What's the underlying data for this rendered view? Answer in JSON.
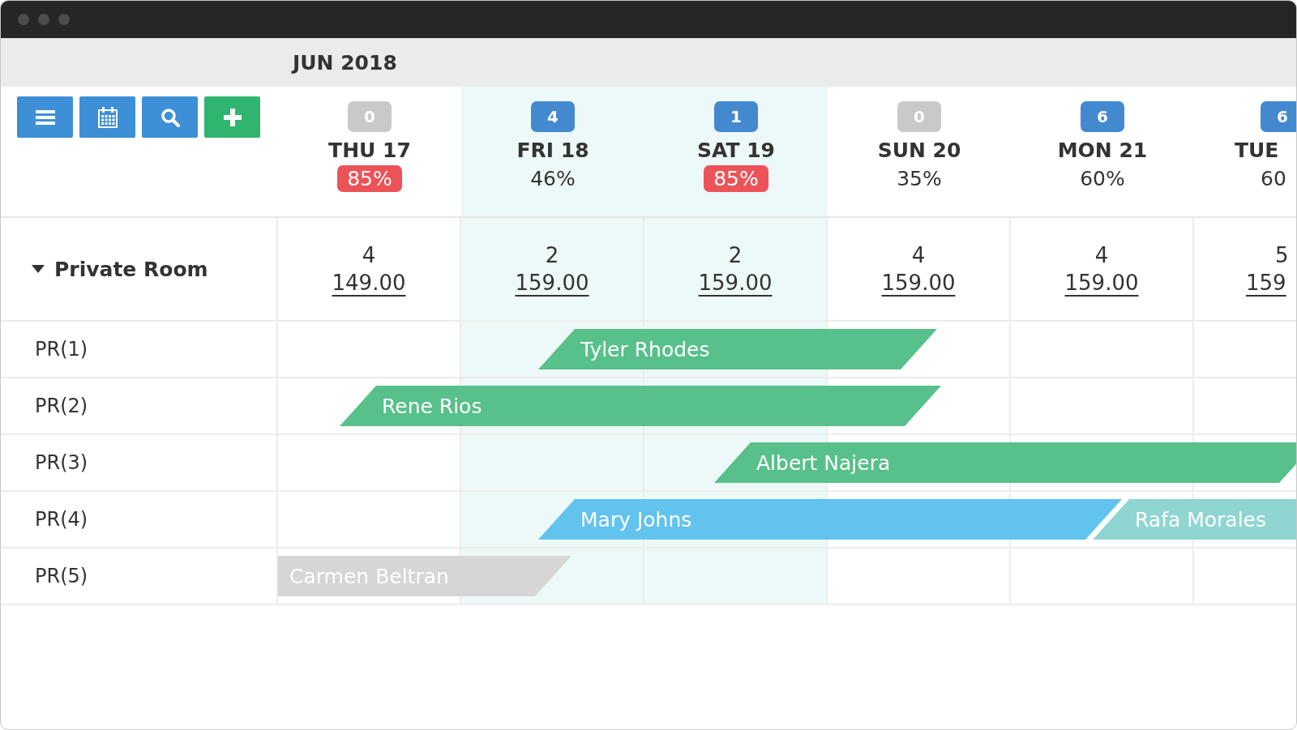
{
  "calendar": {
    "month": "JUN 2018"
  },
  "toolbar": [
    {
      "kind": "menu",
      "color": "#3d8fd6"
    },
    {
      "kind": "calendar",
      "color": "#3d8fd6"
    },
    {
      "kind": "search",
      "color": "#3d8fd6"
    },
    {
      "kind": "add",
      "color": "#2fb56f"
    }
  ],
  "days": [
    {
      "count": "0",
      "badge_active": false,
      "label": "THU 17",
      "occupancy": "85%",
      "alert": true,
      "highlighted": false
    },
    {
      "count": "4",
      "badge_active": true,
      "label": "FRI 18",
      "occupancy": "46%",
      "alert": false,
      "highlighted": true
    },
    {
      "count": "1",
      "badge_active": true,
      "label": "SAT 19",
      "occupancy": "85%",
      "alert": true,
      "highlighted": true
    },
    {
      "count": "0",
      "badge_active": false,
      "label": "SUN 20",
      "occupancy": "35%",
      "alert": false,
      "highlighted": false
    },
    {
      "count": "6",
      "badge_active": true,
      "label": "MON 21",
      "occupancy": "60%",
      "alert": false,
      "highlighted": false
    },
    {
      "count": "6",
      "badge_active": true,
      "label": "TUE",
      "occupancy": "60",
      "alert": false,
      "highlighted": false
    }
  ],
  "room_type": {
    "name": "Private Room",
    "expanded": true,
    "rates": [
      {
        "available": "4",
        "price": "149.00"
      },
      {
        "available": "2",
        "price": "159.00"
      },
      {
        "available": "2",
        "price": "159.00"
      },
      {
        "available": "4",
        "price": "159.00"
      },
      {
        "available": "4",
        "price": "159.00"
      },
      {
        "available": "5",
        "price": "159"
      }
    ]
  },
  "rooms": [
    {
      "name": "PR(1)",
      "bookings": [
        {
          "guest": "Tyler Rhodes",
          "color": "#58c08a"
        }
      ]
    },
    {
      "name": "PR(2)",
      "bookings": [
        {
          "guest": "Rene Rios",
          "color": "#58c08a"
        }
      ]
    },
    {
      "name": "PR(3)",
      "bookings": [
        {
          "guest": "Albert Najera",
          "color": "#58c08a"
        }
      ]
    },
    {
      "name": "PR(4)",
      "bookings": [
        {
          "guest": "Mary Johns",
          "color": "#62c3ee"
        },
        {
          "guest": "Rafa Morales",
          "color": "#8fd6d2"
        }
      ]
    },
    {
      "name": "PR(5)",
      "bookings": [
        {
          "guest": "Carmen Beltran",
          "color": "#d6d6d6"
        }
      ]
    }
  ]
}
